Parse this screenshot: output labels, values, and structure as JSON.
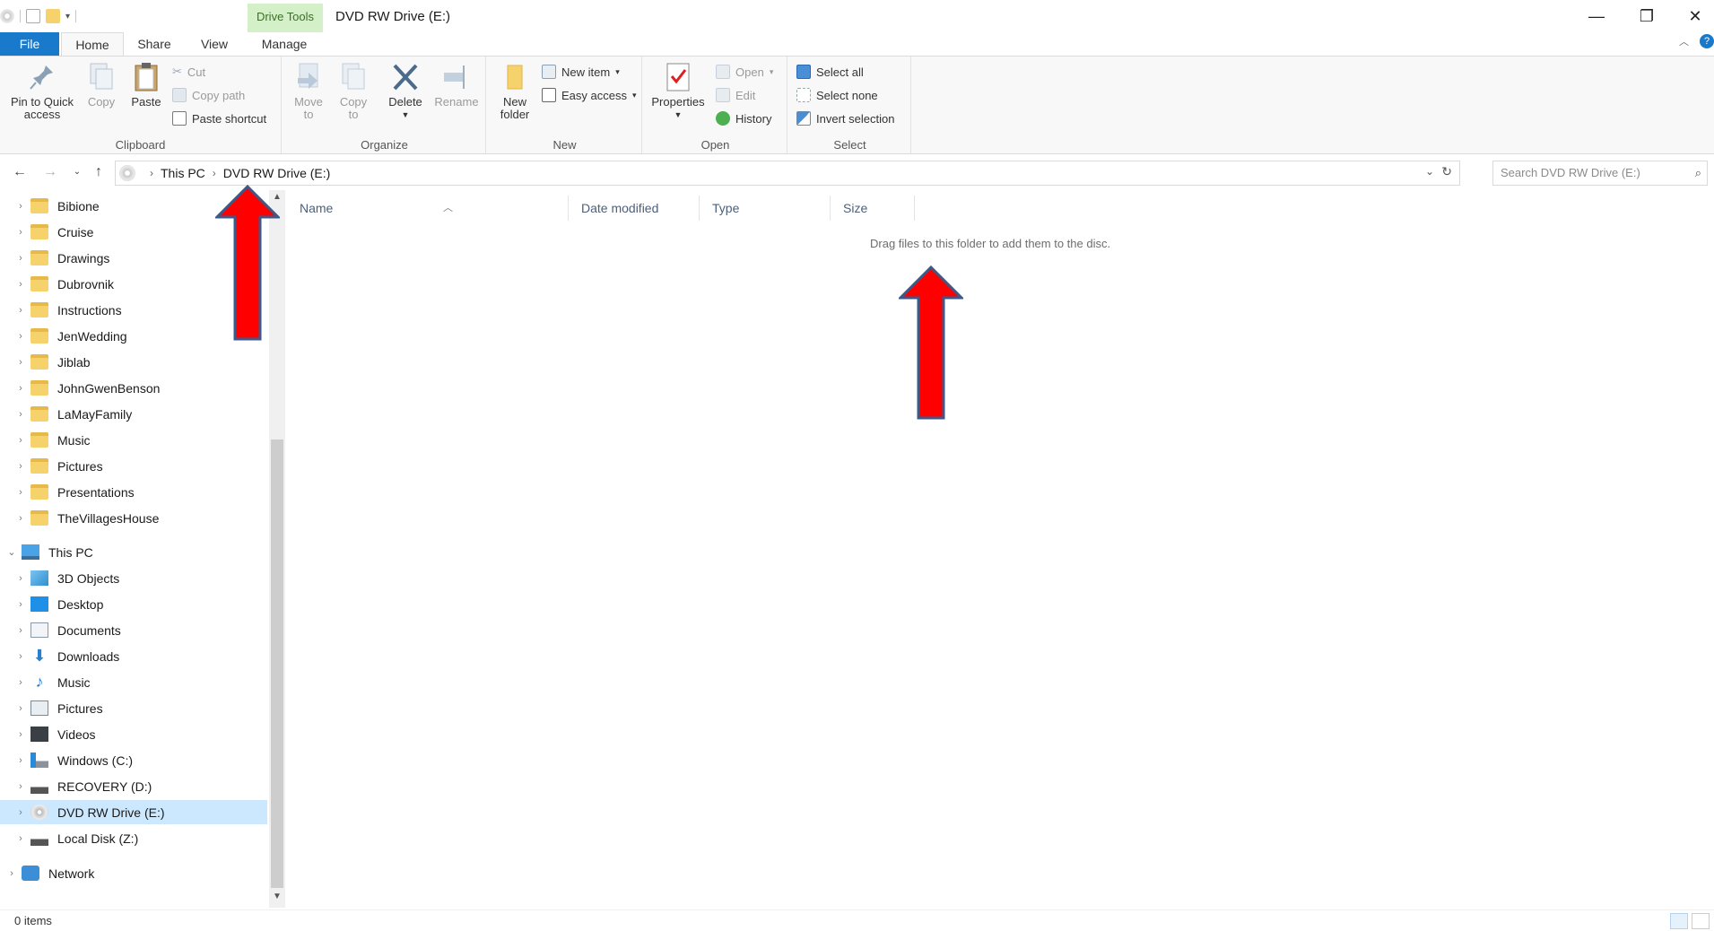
{
  "window": {
    "title": "DVD RW Drive (E:)",
    "contextual_group": "Drive Tools",
    "controls": {
      "minimize": "—",
      "restore": "❐",
      "close": "✕"
    }
  },
  "tabs": {
    "file": "File",
    "home": "Home",
    "share": "Share",
    "view": "View",
    "manage": "Manage"
  },
  "ribbon": {
    "clipboard": {
      "label": "Clipboard",
      "pin": "Pin to Quick access",
      "copy": "Copy",
      "paste": "Paste",
      "cut": "Cut",
      "copy_path": "Copy path",
      "paste_shortcut": "Paste shortcut"
    },
    "organize": {
      "label": "Organize",
      "move_to": "Move to",
      "copy_to": "Copy to",
      "delete": "Delete",
      "rename": "Rename"
    },
    "new": {
      "label": "New",
      "new_folder": "New folder",
      "new_item": "New item",
      "easy_access": "Easy access"
    },
    "open": {
      "label": "Open",
      "properties": "Properties",
      "open": "Open",
      "edit": "Edit",
      "history": "History"
    },
    "select": {
      "label": "Select",
      "select_all": "Select all",
      "select_none": "Select none",
      "invert_selection": "Invert selection"
    }
  },
  "address": {
    "crumbs": [
      "This PC",
      "DVD RW Drive (E:)"
    ],
    "search_placeholder": "Search DVD RW Drive (E:)"
  },
  "nav_tree": {
    "folders": [
      "Bibione",
      "Cruise",
      "Drawings",
      "Dubrovnik",
      "Instructions",
      "JenWedding",
      "Jiblab",
      "JohnGwenBenson",
      "LaMayFamily",
      "Music",
      "Pictures",
      "Presentations",
      "TheVillagesHouse"
    ],
    "this_pc": "This PC",
    "pc_items": [
      "3D Objects",
      "Desktop",
      "Documents",
      "Downloads",
      "Music",
      "Pictures",
      "Videos",
      "Windows (C:)",
      "RECOVERY (D:)",
      "DVD RW Drive (E:)",
      "Local Disk (Z:)"
    ],
    "network": "Network",
    "selected": "DVD RW Drive (E:)"
  },
  "columns": {
    "name": "Name",
    "date_modified": "Date modified",
    "type": "Type",
    "size": "Size"
  },
  "content": {
    "empty_message": "Drag files to this folder to add them to the disc."
  },
  "status": {
    "items": "0 items"
  },
  "colors": {
    "accent": "#1979ca",
    "selected": "#cce8ff",
    "arrow_fill": "#ff0000",
    "arrow_stroke": "#3a5a8c"
  }
}
